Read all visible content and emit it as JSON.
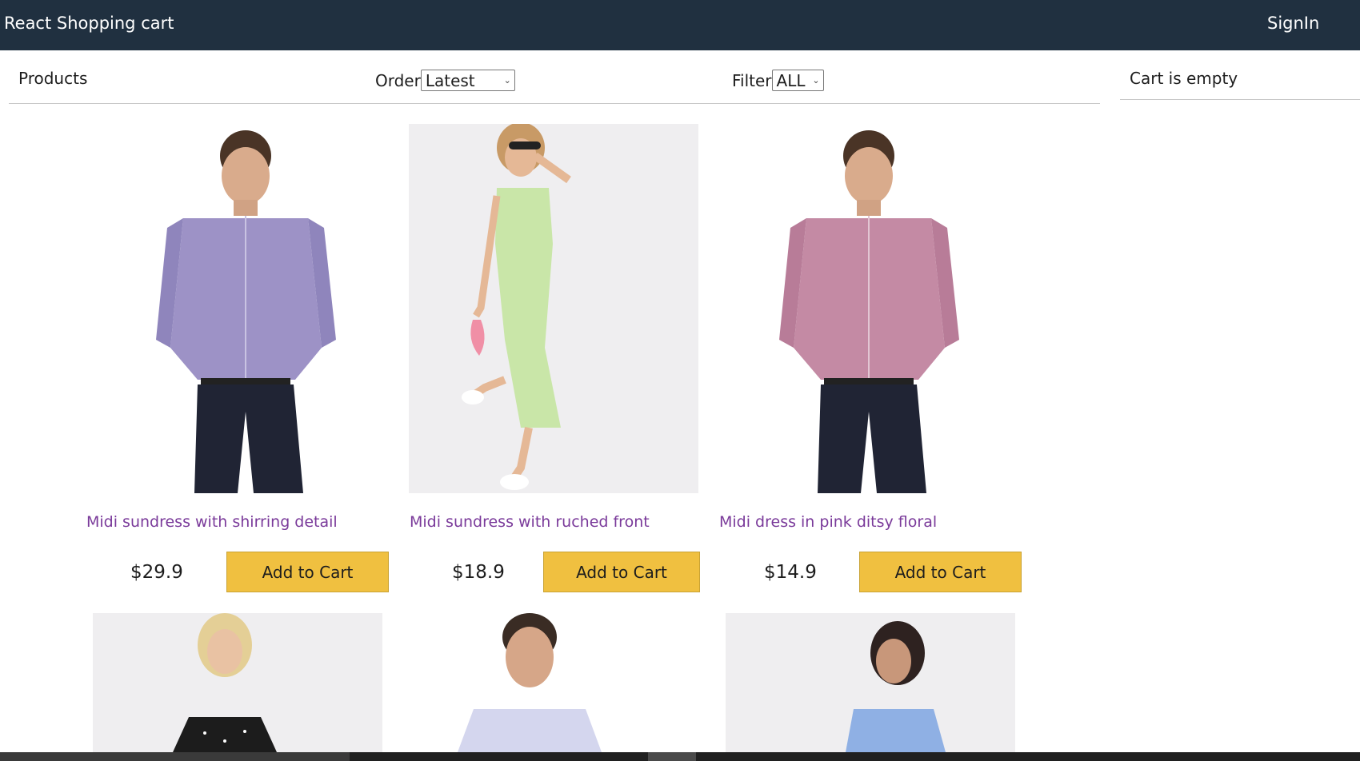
{
  "header": {
    "brand": "React Shopping cart",
    "signin": "SignIn"
  },
  "filter": {
    "count_label": "Products",
    "order_label": "Order",
    "order_selected": "Latest",
    "filter_label": "Filter",
    "filter_selected": "ALL"
  },
  "cart": {
    "empty_text": "Cart is empty"
  },
  "products": [
    {
      "title": "Midi sundress with shirring detail",
      "price": "$29.9",
      "button": "Add to Cart"
    },
    {
      "title": "Midi sundress with ruched front",
      "price": "$18.9",
      "button": "Add to Cart"
    },
    {
      "title": "Midi dress in pink ditsy floral",
      "price": "$14.9",
      "button": "Add to Cart"
    }
  ],
  "colors": {
    "header_bg": "#203040",
    "button_bg": "#f0c040",
    "title_link": "#7a3a9a"
  }
}
